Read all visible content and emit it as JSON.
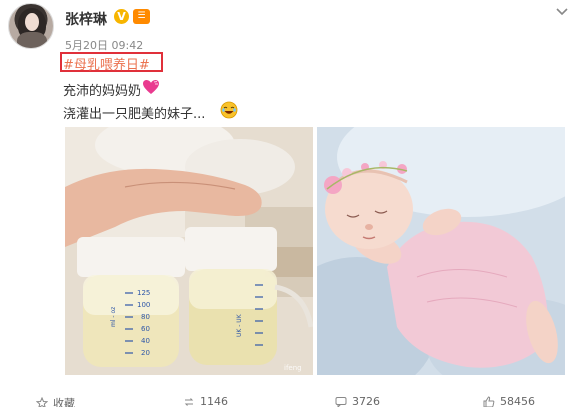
{
  "post": {
    "author": "张梓琳",
    "timestamp": "5月20日 09:42",
    "hashtag": "#母乳喂养日#",
    "text_line1": "充沛的妈妈奶",
    "text_line2": "浇灌出一只肥美的妹子..."
  },
  "images": {
    "left": {
      "bottle_marks": [
        "125",
        "100",
        "80",
        "60",
        "40",
        "20"
      ],
      "bottle_side_text": "ml - oz",
      "bottle_right_text": "UK - UK",
      "watermark": "ifeng"
    }
  },
  "actions": {
    "favorite": "收藏",
    "repost_count": "1146",
    "comment_count": "3726",
    "like_count": "58456"
  },
  "colors": {
    "hashtag": "#eb7350",
    "highlight_border": "#e0303a",
    "verify": "#f7b500"
  },
  "icons": [
    "chevron-down-icon",
    "verify-icon",
    "vip-icon",
    "heart-icon",
    "laugh-icon",
    "favorite-icon",
    "repost-icon",
    "comment-icon",
    "like-icon"
  ]
}
